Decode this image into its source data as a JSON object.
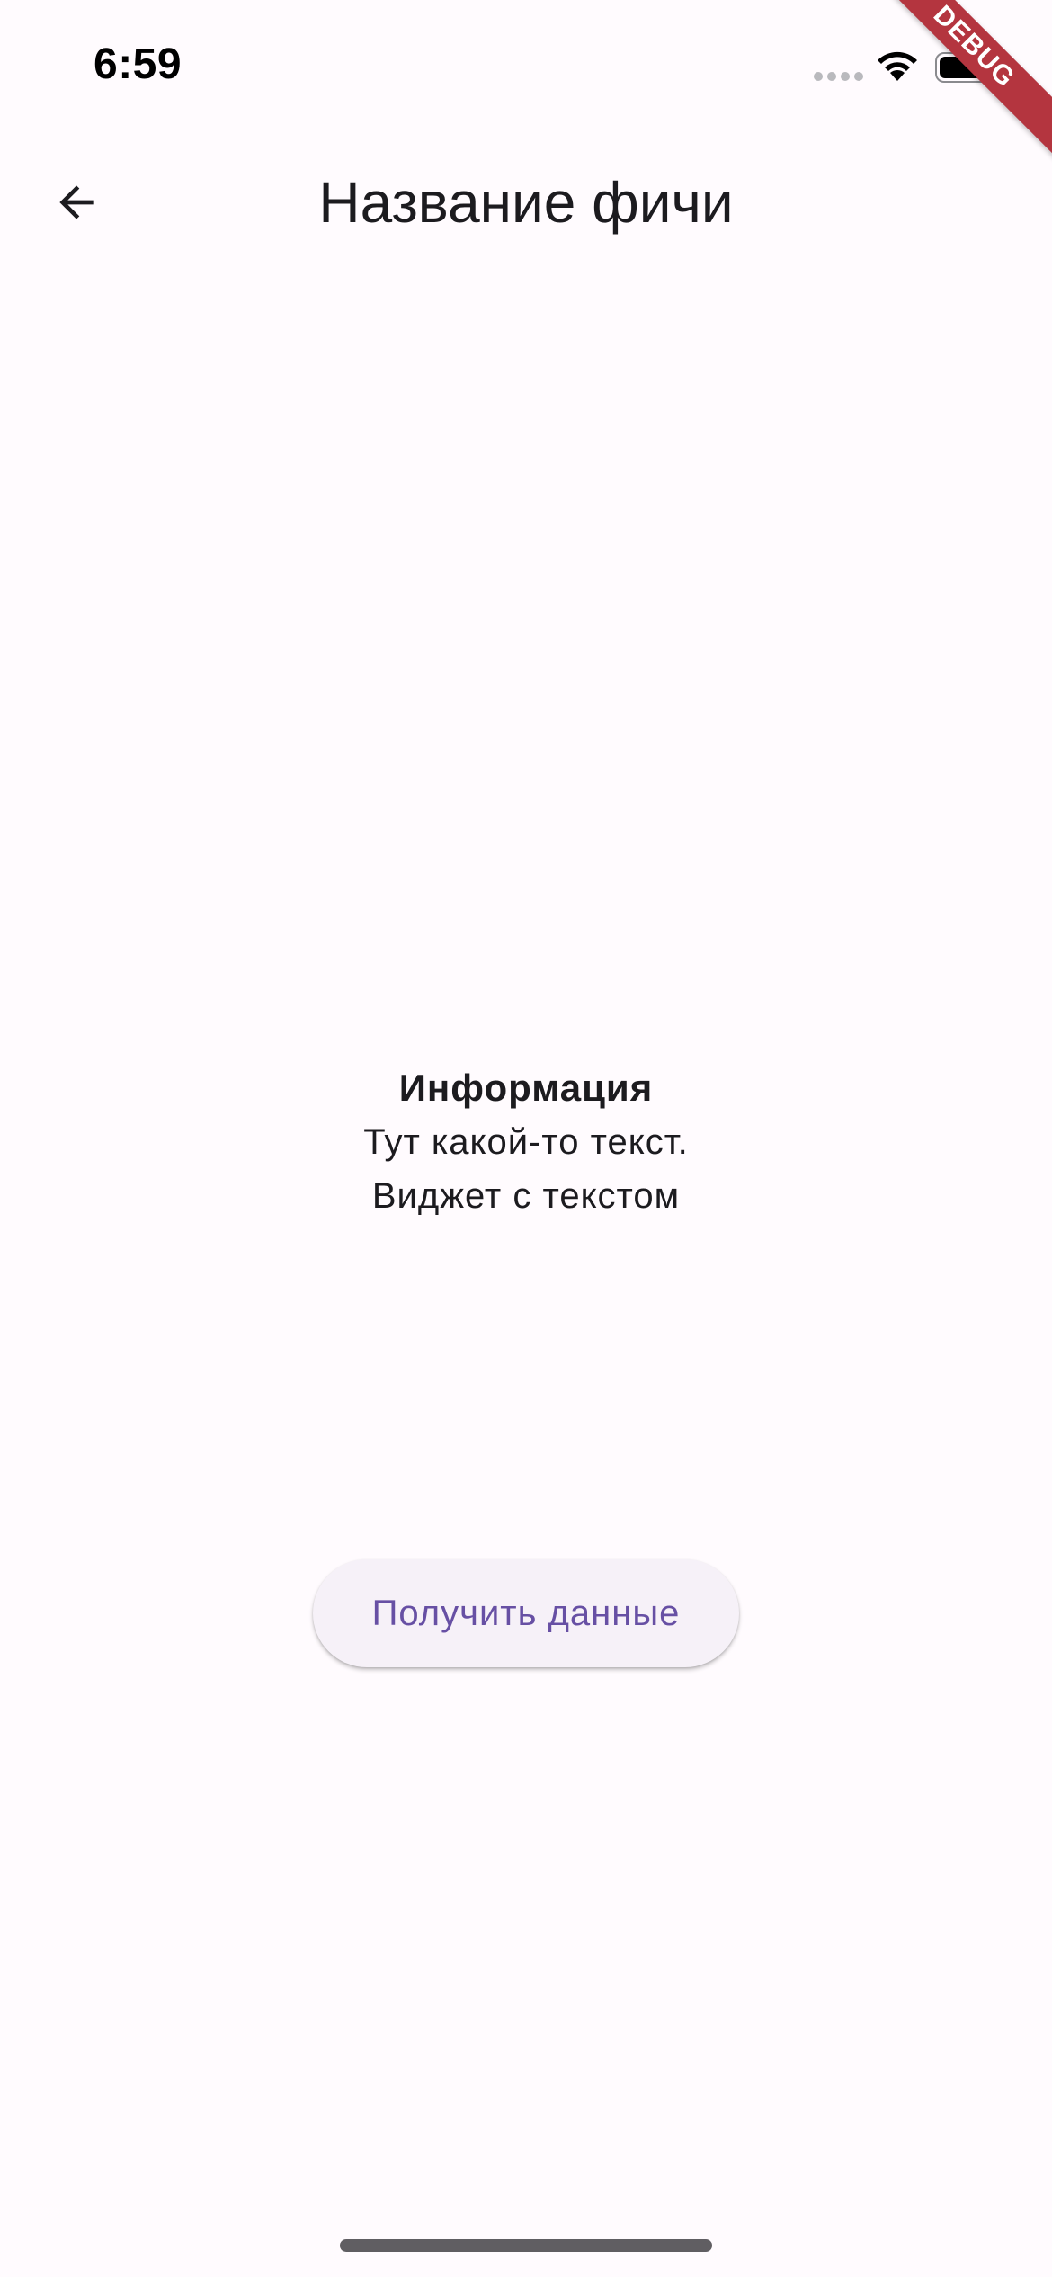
{
  "status_bar": {
    "time": "6:59",
    "debug_label": "DEBUG"
  },
  "app_bar": {
    "title": "Название фичи",
    "back_icon": "arrow-back-icon"
  },
  "info": {
    "title": "Информация",
    "line1": "Тут какой-то текст.",
    "line2": "Виджет с текстом"
  },
  "actions": {
    "fetch_label": "Получить данные"
  },
  "colors": {
    "background": "#fffbfe",
    "accent": "#6750a4",
    "debug_banner": "#b4353f"
  }
}
